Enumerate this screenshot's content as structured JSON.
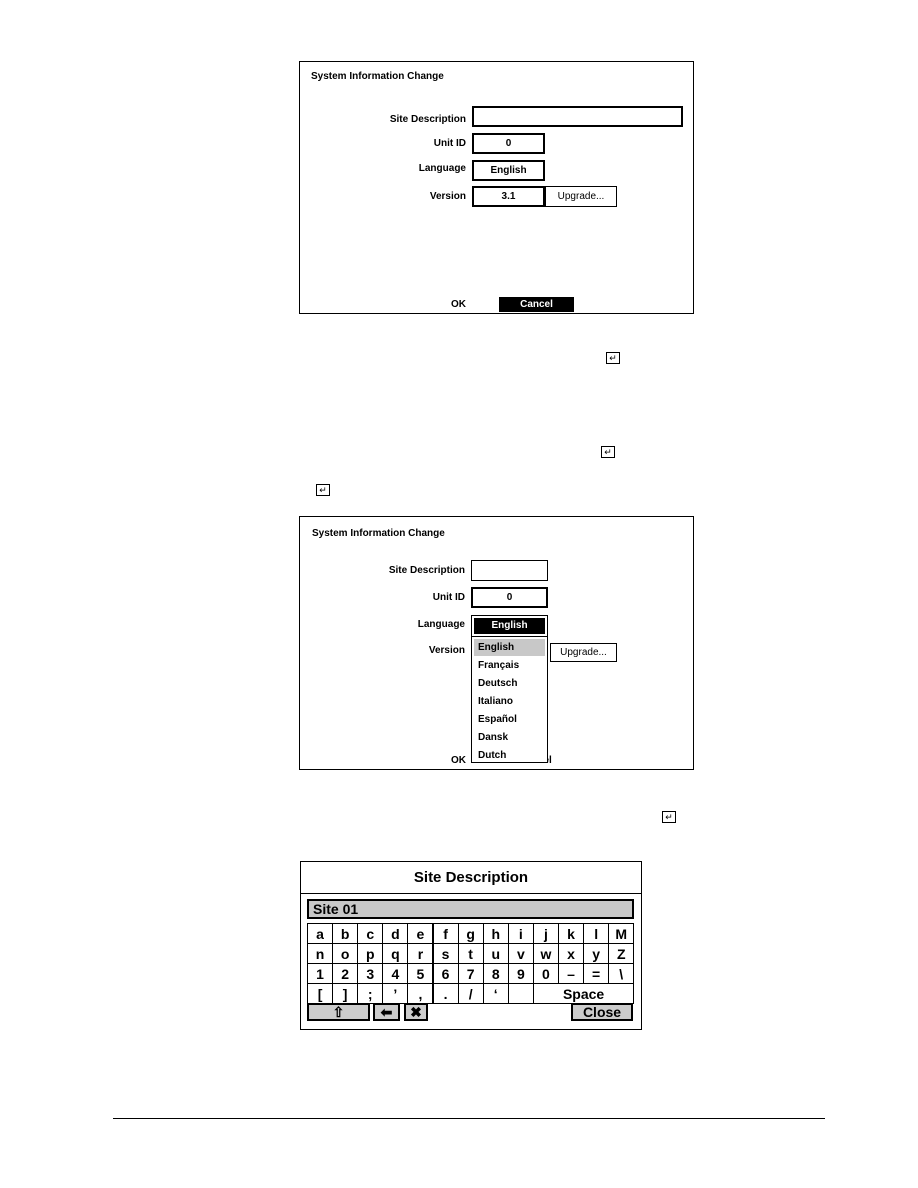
{
  "panel1": {
    "title": "System Information Change",
    "site_label": "Site Description",
    "site_value": "",
    "unit_label": "Unit ID",
    "unit_value": "0",
    "lang_label": "Language",
    "lang_value": "English",
    "version_label": "Version",
    "version_value": "3.1",
    "upgrade": "Upgrade...",
    "ok": "OK",
    "cancel": "Cancel"
  },
  "panel2": {
    "title": "System Information Change",
    "site_label": "Site Description",
    "unit_label": "Unit ID",
    "unit_value": "0",
    "lang_label": "Language",
    "lang_value": "English",
    "version_label": "Version",
    "upgrade": "Upgrade...",
    "ok": "OK",
    "cancel": "Cancel",
    "options": [
      "English",
      "Français",
      "Deutsch",
      "Italiano",
      "Español",
      "Dansk",
      "Dutch"
    ],
    "highlighted": "English"
  },
  "keyboard": {
    "title": "Site Description",
    "input_value": "Site 01",
    "rows": [
      [
        "a",
        "b",
        "c",
        "d",
        "e",
        "f",
        "g",
        "h",
        "i",
        "j",
        "k",
        "l",
        "M"
      ],
      [
        "n",
        "o",
        "p",
        "q",
        "r",
        "s",
        "t",
        "u",
        "v",
        "w",
        "x",
        "y",
        "Z"
      ],
      [
        "1",
        "2",
        "3",
        "4",
        "5",
        "6",
        "7",
        "8",
        "9",
        "0",
        "–",
        "=",
        "\\"
      ],
      [
        "[",
        "]",
        ";",
        "’",
        ",",
        ".",
        "/",
        "‘",
        ""
      ]
    ],
    "space": "Space",
    "close": "Close",
    "shift_icon": "shift-arrow-icon",
    "backspace_icon": "left-arrow-icon",
    "clear_icon": "x-icon"
  },
  "icons": {
    "enter": "enter-key-icon",
    "enter_glyph": "↵"
  }
}
